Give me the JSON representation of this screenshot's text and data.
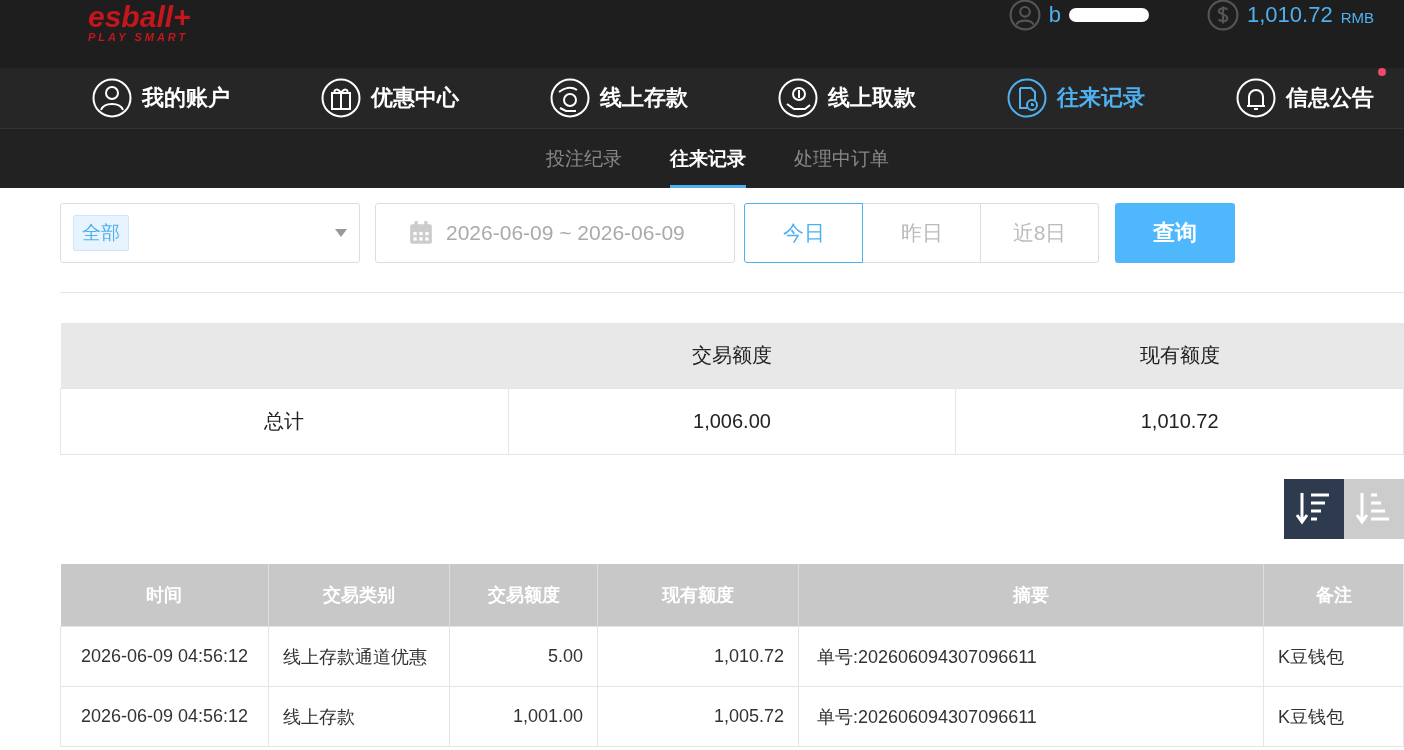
{
  "header": {
    "logo": "esball+",
    "tagline": "PLAY SMART",
    "username": "b",
    "balance": "1,010.72",
    "currency": "RMB"
  },
  "nav": [
    {
      "label": "我的账户",
      "kind": "user",
      "selected": false,
      "badge": false
    },
    {
      "label": "优惠中心",
      "kind": "gift",
      "selected": false,
      "badge": false
    },
    {
      "label": "线上存款",
      "kind": "deposit",
      "selected": false,
      "badge": false
    },
    {
      "label": "线上取款",
      "kind": "withdraw",
      "selected": false,
      "badge": false
    },
    {
      "label": "往来记录",
      "kind": "record",
      "selected": true,
      "badge": false
    },
    {
      "label": "信息公告",
      "kind": "bell",
      "selected": false,
      "badge": true
    }
  ],
  "subtabs": [
    {
      "label": "投注纪录",
      "selected": false
    },
    {
      "label": "往来记录",
      "selected": true
    },
    {
      "label": "处理中订单",
      "selected": false
    }
  ],
  "filter": {
    "type_tag": "全部",
    "date_range": "2026-06-09 ~ 2026-06-09",
    "ranges": [
      {
        "label": "今日",
        "selected": true
      },
      {
        "label": "昨日",
        "selected": false
      },
      {
        "label": "近8日",
        "selected": false
      }
    ],
    "query_button": "查询"
  },
  "summary": {
    "columns": [
      "交易额度",
      "现有额度"
    ],
    "row": {
      "label": "总计",
      "values": [
        "1,006.00",
        "1,010.72"
      ]
    }
  },
  "sort": [
    {
      "kind": "desc",
      "selected": true
    },
    {
      "kind": "asc",
      "selected": false
    }
  ],
  "table": {
    "columns": [
      "时间",
      "交易类别",
      "交易额度",
      "现有额度",
      "摘要",
      "备注"
    ],
    "rows": [
      [
        "2026-06-09 04:56:12",
        "线上存款通道优惠",
        "5.00",
        "1,010.72",
        "单号:202606094307096611",
        "K豆钱包"
      ],
      [
        "2026-06-09 04:56:12",
        "线上存款",
        "1,001.00",
        "1,005.72",
        "单号:202606094307096611",
        "K豆钱包"
      ]
    ]
  }
}
